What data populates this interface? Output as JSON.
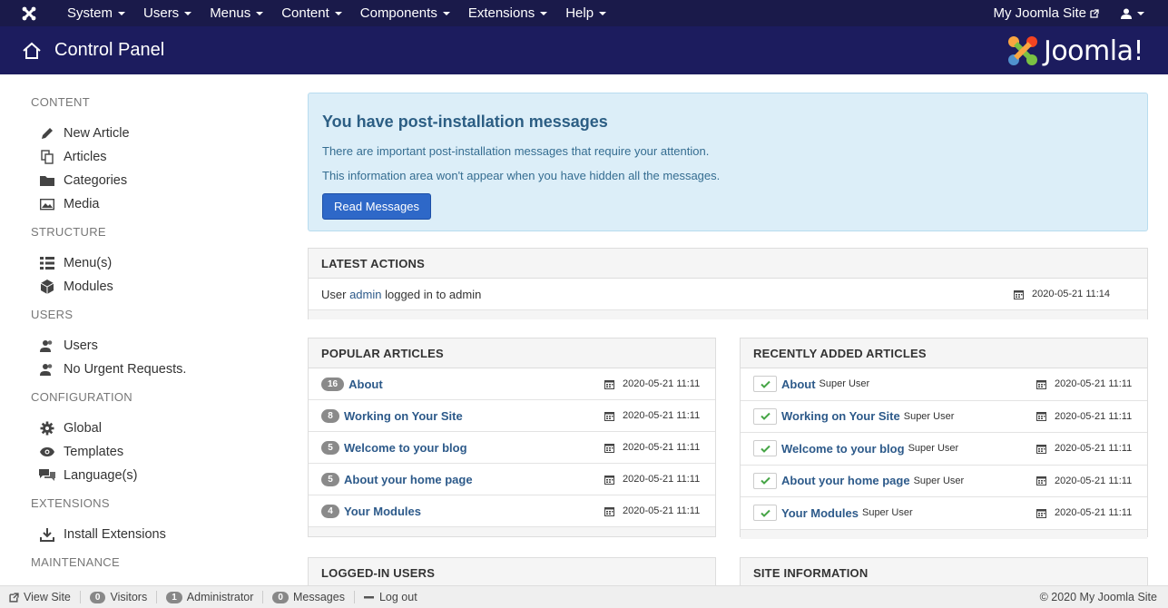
{
  "topnav": {
    "menus": [
      "System",
      "Users",
      "Menus",
      "Content",
      "Components",
      "Extensions",
      "Help"
    ],
    "site_link": "My Joomla Site"
  },
  "header": {
    "title": "Control Panel",
    "brand": "Joomla!"
  },
  "sidebar": {
    "sections": [
      {
        "heading": "CONTENT",
        "items": [
          {
            "label": "New Article",
            "icon": "pencil-icon"
          },
          {
            "label": "Articles",
            "icon": "copy-icon"
          },
          {
            "label": "Categories",
            "icon": "folder-icon"
          },
          {
            "label": "Media",
            "icon": "image-icon"
          }
        ]
      },
      {
        "heading": "STRUCTURE",
        "items": [
          {
            "label": "Menu(s)",
            "icon": "list-icon"
          },
          {
            "label": "Modules",
            "icon": "cube-icon"
          }
        ]
      },
      {
        "heading": "USERS",
        "items": [
          {
            "label": "Users",
            "icon": "users-icon"
          },
          {
            "label": "No Urgent Requests.",
            "icon": "users-icon"
          }
        ]
      },
      {
        "heading": "CONFIGURATION",
        "items": [
          {
            "label": "Global",
            "icon": "cog-icon"
          },
          {
            "label": "Templates",
            "icon": "eye-icon"
          },
          {
            "label": "Language(s)",
            "icon": "comments-icon"
          }
        ]
      },
      {
        "heading": "EXTENSIONS",
        "items": [
          {
            "label": "Install Extensions",
            "icon": "download-icon"
          }
        ]
      },
      {
        "heading": "MAINTENANCE",
        "items": []
      }
    ]
  },
  "alert": {
    "title": "You have post-installation messages",
    "line1": "There are important post-installation messages that require your attention.",
    "line2": "This information area won't appear when you have hidden all the messages.",
    "button": "Read Messages"
  },
  "latest_actions": {
    "heading": "LATEST ACTIONS",
    "rows": [
      {
        "prefix": "User ",
        "link": "admin",
        "suffix": " logged in to admin",
        "date": "2020-05-21 11:14"
      }
    ]
  },
  "popular_articles": {
    "heading": "POPULAR ARTICLES",
    "rows": [
      {
        "hits": "16",
        "title": "About",
        "date": "2020-05-21 11:11"
      },
      {
        "hits": "8",
        "title": "Working on Your Site",
        "date": "2020-05-21 11:11"
      },
      {
        "hits": "5",
        "title": "Welcome to your blog",
        "date": "2020-05-21 11:11"
      },
      {
        "hits": "5",
        "title": "About your home page",
        "date": "2020-05-21 11:11"
      },
      {
        "hits": "4",
        "title": "Your Modules",
        "date": "2020-05-21 11:11"
      }
    ]
  },
  "recent_articles": {
    "heading": "RECENTLY ADDED ARTICLES",
    "rows": [
      {
        "title": "About",
        "author": "Super User",
        "date": "2020-05-21 11:11"
      },
      {
        "title": "Working on Your Site",
        "author": "Super User",
        "date": "2020-05-21 11:11"
      },
      {
        "title": "Welcome to your blog",
        "author": "Super User",
        "date": "2020-05-21 11:11"
      },
      {
        "title": "About your home page",
        "author": "Super User",
        "date": "2020-05-21 11:11"
      },
      {
        "title": "Your Modules",
        "author": "Super User",
        "date": "2020-05-21 11:11"
      }
    ]
  },
  "logged_in_users": {
    "heading": "LOGGED-IN USERS"
  },
  "site_information": {
    "heading": "SITE INFORMATION"
  },
  "statusbar": {
    "view_site": "View Site",
    "visitors_count": "0",
    "visitors": "Visitors",
    "admin_count": "1",
    "administrator": "Administrator",
    "messages_count": "0",
    "messages": "Messages",
    "logout": "Log out",
    "copyright": "© 2020 My Joomla Site"
  }
}
